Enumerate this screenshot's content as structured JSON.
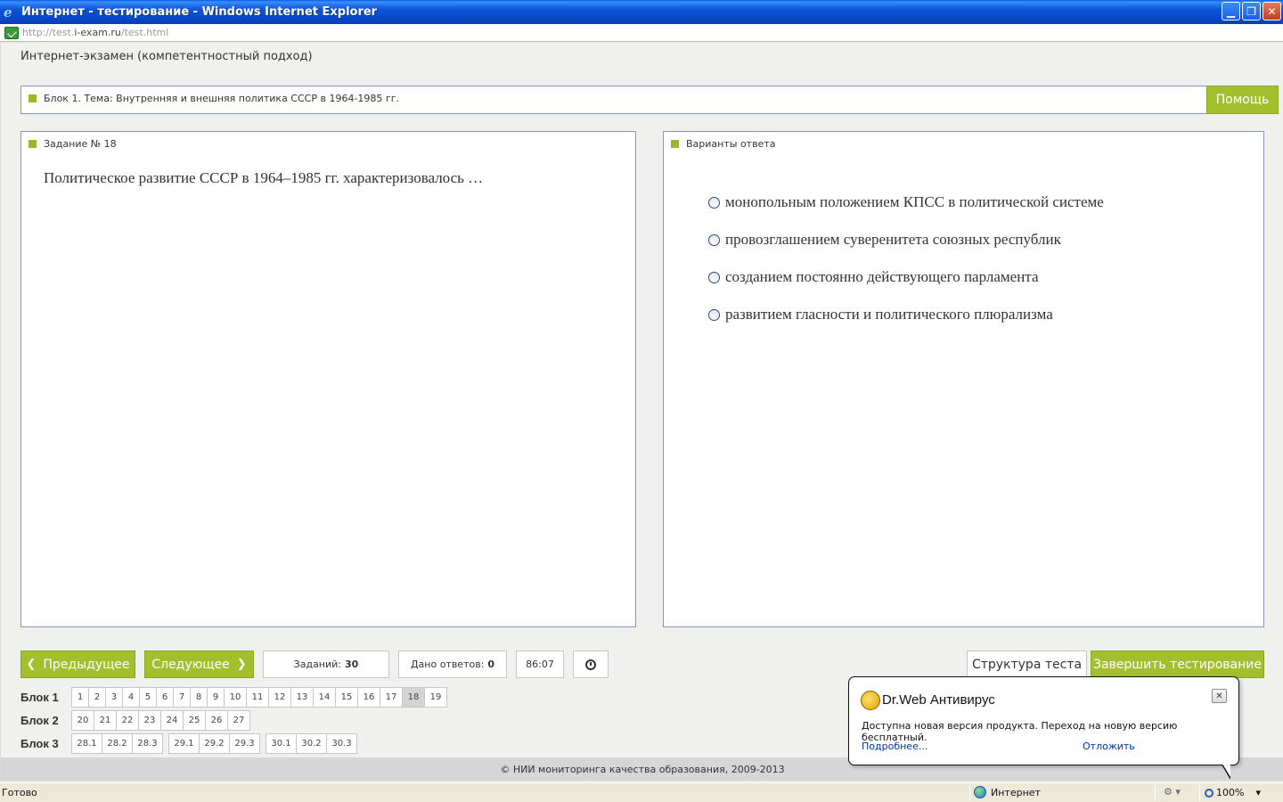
{
  "window": {
    "title": "Интернет - тестирование - Windows Internet Explorer",
    "url_prefix": "http://test.",
    "url_host": "i-exam.ru",
    "url_path": "/test.html"
  },
  "page": {
    "header": "Интернет-экзамен (компетентностный подход)",
    "block_title": "Блок 1. Тема: Внутренняя и внешняя политика СССР в 1964-1985 гг.",
    "help_label": "Помощь",
    "task_label": "Задание № 18",
    "question": "Политическое развитие СССР в 1964–1985 гг. характеризовалось …",
    "answers_label": "Варианты ответа",
    "options": [
      "монопольным положением КПСС в политической системе",
      "провозглашением суверенитета союзных республик",
      "созданием постоянно действующего парламента",
      "развитием гласности и политического плюрализма"
    ]
  },
  "controls": {
    "prev_label": "Предыдущее",
    "next_label": "Следующее",
    "tasks_label": "Заданий:",
    "tasks_count": "30",
    "answered_label": "Дано ответов:",
    "answered_count": "0",
    "timer": "86:07",
    "structure_label": "Структура теста",
    "finish_label": "Завершить тестирование"
  },
  "blocks": [
    {
      "name": "Блок 1",
      "groups": [
        [
          "1",
          "2",
          "3",
          "4",
          "5",
          "6",
          "7",
          "8",
          "9",
          "10",
          "11",
          "12",
          "13",
          "14",
          "15",
          "16",
          "17",
          "18",
          "19"
        ]
      ],
      "active": "18"
    },
    {
      "name": "Блок 2",
      "groups": [
        [
          "20",
          "21",
          "22",
          "23",
          "24",
          "25",
          "26",
          "27"
        ]
      ]
    },
    {
      "name": "Блок 3",
      "groups": [
        [
          "28.1",
          "28.2",
          "28.3"
        ],
        [
          "29.1",
          "29.2",
          "29.3"
        ],
        [
          "30.1",
          "30.2",
          "30.3"
        ]
      ]
    }
  ],
  "footer": "© НИИ мониторинга качества образования, 2009-2013",
  "drweb": {
    "title": "Dr.Web Антивирус",
    "message": "Доступна новая версия продукта. Переход на новую версию бесплатный.",
    "more_link": "Подробнее...",
    "postpone_link": "Отложить",
    "close_glyph": "✕"
  },
  "status": {
    "left": "Готово",
    "zone": "Интернет",
    "zoom": "100%"
  }
}
